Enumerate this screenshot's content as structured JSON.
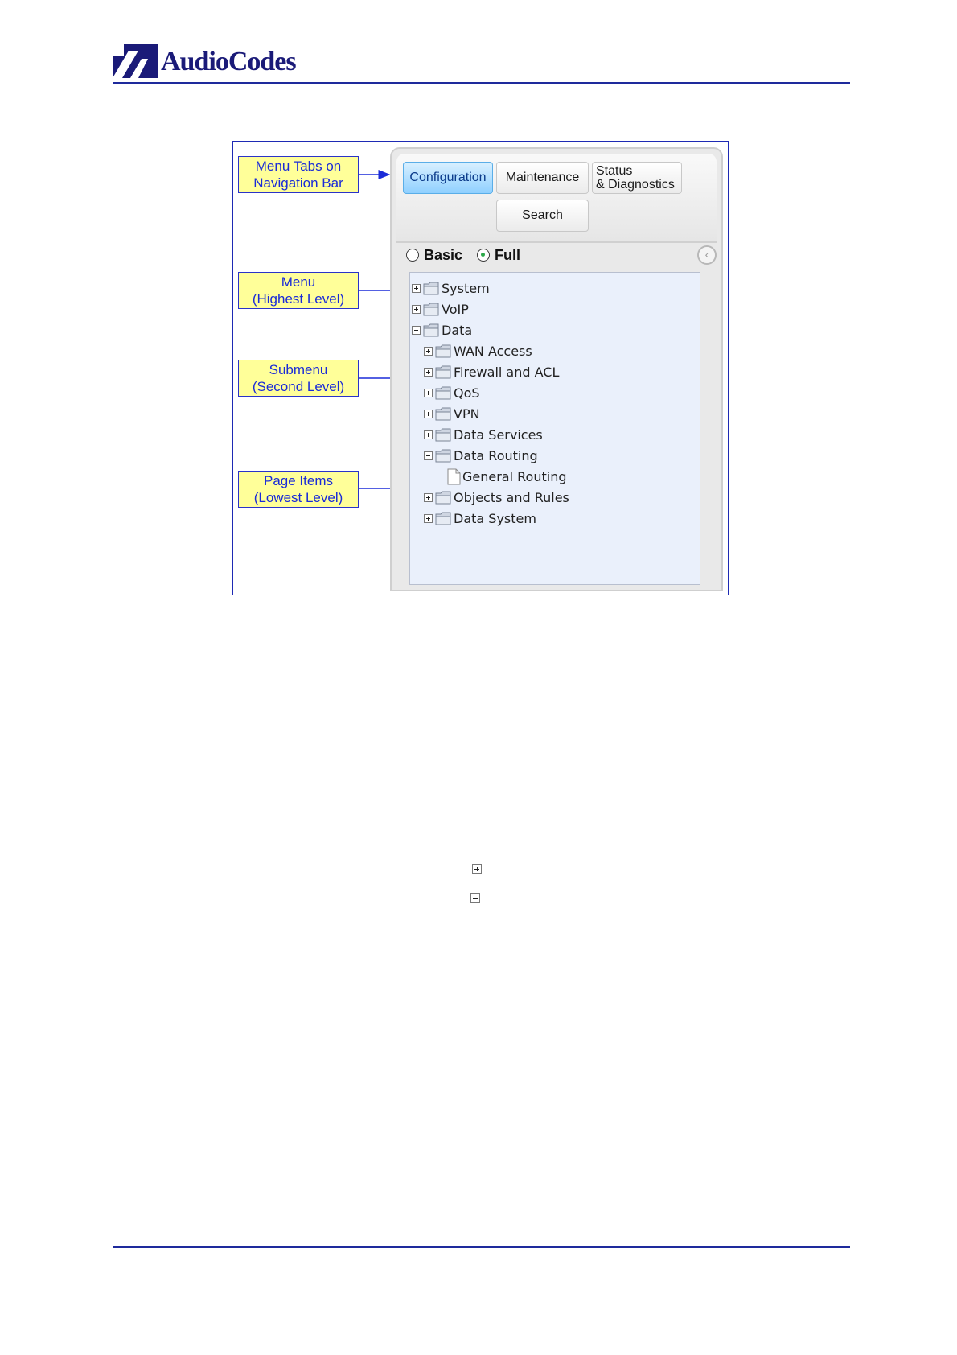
{
  "header": {
    "brand": "AudioCodes",
    "logo_icon": "audiocodes-logo-icon",
    "rule_color": "#1e2a9c"
  },
  "figure": {
    "callouts": [
      "Menu Tabs on\nNavigation Bar",
      "Menu\n(Highest Level)",
      "Submenu\n(Second Level)",
      "Page Items\n(Lowest Level)"
    ],
    "callout_color": "#ffff99",
    "arrow_color": "#1a2bd8",
    "nav": {
      "tabs": [
        "Configuration",
        "Maintenance",
        "Status\n& Diagnostics",
        "Search"
      ],
      "active_tab": "Configuration",
      "modes": [
        "Basic",
        "Full"
      ],
      "selected_mode": "Full",
      "tree": [
        {
          "label": "System",
          "level": 1,
          "type": "folder",
          "expanded": false
        },
        {
          "label": "VoIP",
          "level": 1,
          "type": "folder",
          "expanded": false
        },
        {
          "label": "Data",
          "level": 1,
          "type": "folder",
          "expanded": true
        },
        {
          "label": "WAN Access",
          "level": 2,
          "type": "folder",
          "expanded": false
        },
        {
          "label": "Firewall and ACL",
          "level": 2,
          "type": "folder",
          "expanded": false
        },
        {
          "label": "QoS",
          "level": 2,
          "type": "folder",
          "expanded": false
        },
        {
          "label": "VPN",
          "level": 2,
          "type": "folder",
          "expanded": false
        },
        {
          "label": "Data Services",
          "level": 2,
          "type": "folder",
          "expanded": false
        },
        {
          "label": "Data Routing",
          "level": 2,
          "type": "folder",
          "expanded": true
        },
        {
          "label": "General Routing",
          "level": 3,
          "type": "page"
        },
        {
          "label": "Objects and Rules",
          "level": 2,
          "type": "folder",
          "expanded": false
        },
        {
          "label": "Data System",
          "level": 2,
          "type": "folder",
          "expanded": false
        }
      ]
    }
  },
  "legend_icons": [
    "expand-plus-icon",
    "collapse-minus-icon"
  ]
}
